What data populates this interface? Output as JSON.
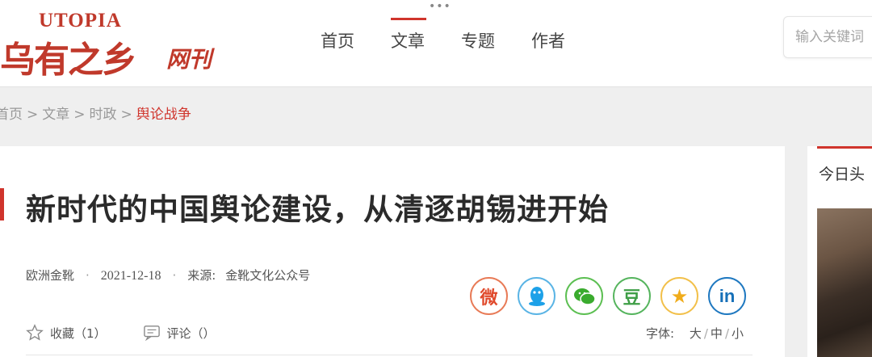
{
  "header": {
    "more_dots": "•••",
    "logo": {
      "english": "UTOPIA",
      "chinese": "乌有之乡",
      "sub": "网刊"
    },
    "nav": [
      {
        "label": "首页",
        "active": false
      },
      {
        "label": "文章",
        "active": true
      },
      {
        "label": "专题",
        "active": false
      },
      {
        "label": "作者",
        "active": false
      }
    ],
    "search": {
      "placeholder": "输入关键词"
    }
  },
  "breadcrumb": [
    {
      "label": "首页"
    },
    {
      "label": "文章"
    },
    {
      "label": "时政"
    },
    {
      "label": "舆论战争",
      "current": true
    }
  ],
  "breadcrumb_sep": ">",
  "article": {
    "title": "新时代的中国舆论建设，从清逐胡锡进开始",
    "author": "欧洲金靴",
    "date": "2021-12-18",
    "source_label": "来源:",
    "source": "金靴文化公众号",
    "meta_dot": "·",
    "share": [
      {
        "name": "weibo",
        "glyph": "微"
      },
      {
        "name": "qq",
        "glyph": "Q"
      },
      {
        "name": "wechat",
        "glyph": "W"
      },
      {
        "name": "douban",
        "glyph": "豆"
      },
      {
        "name": "qzone",
        "glyph": "★"
      },
      {
        "name": "linkedin",
        "glyph": "in"
      }
    ],
    "collect_label": "收藏（1）",
    "comment_label": "评论（）",
    "font_size_label": "字体:",
    "font_size_options": [
      "大",
      "中",
      "小"
    ],
    "font_size_sep": "/"
  },
  "sidebar": {
    "title": "今日头"
  },
  "colors": {
    "accent": "#d0342c",
    "logo": "#c0392b"
  }
}
